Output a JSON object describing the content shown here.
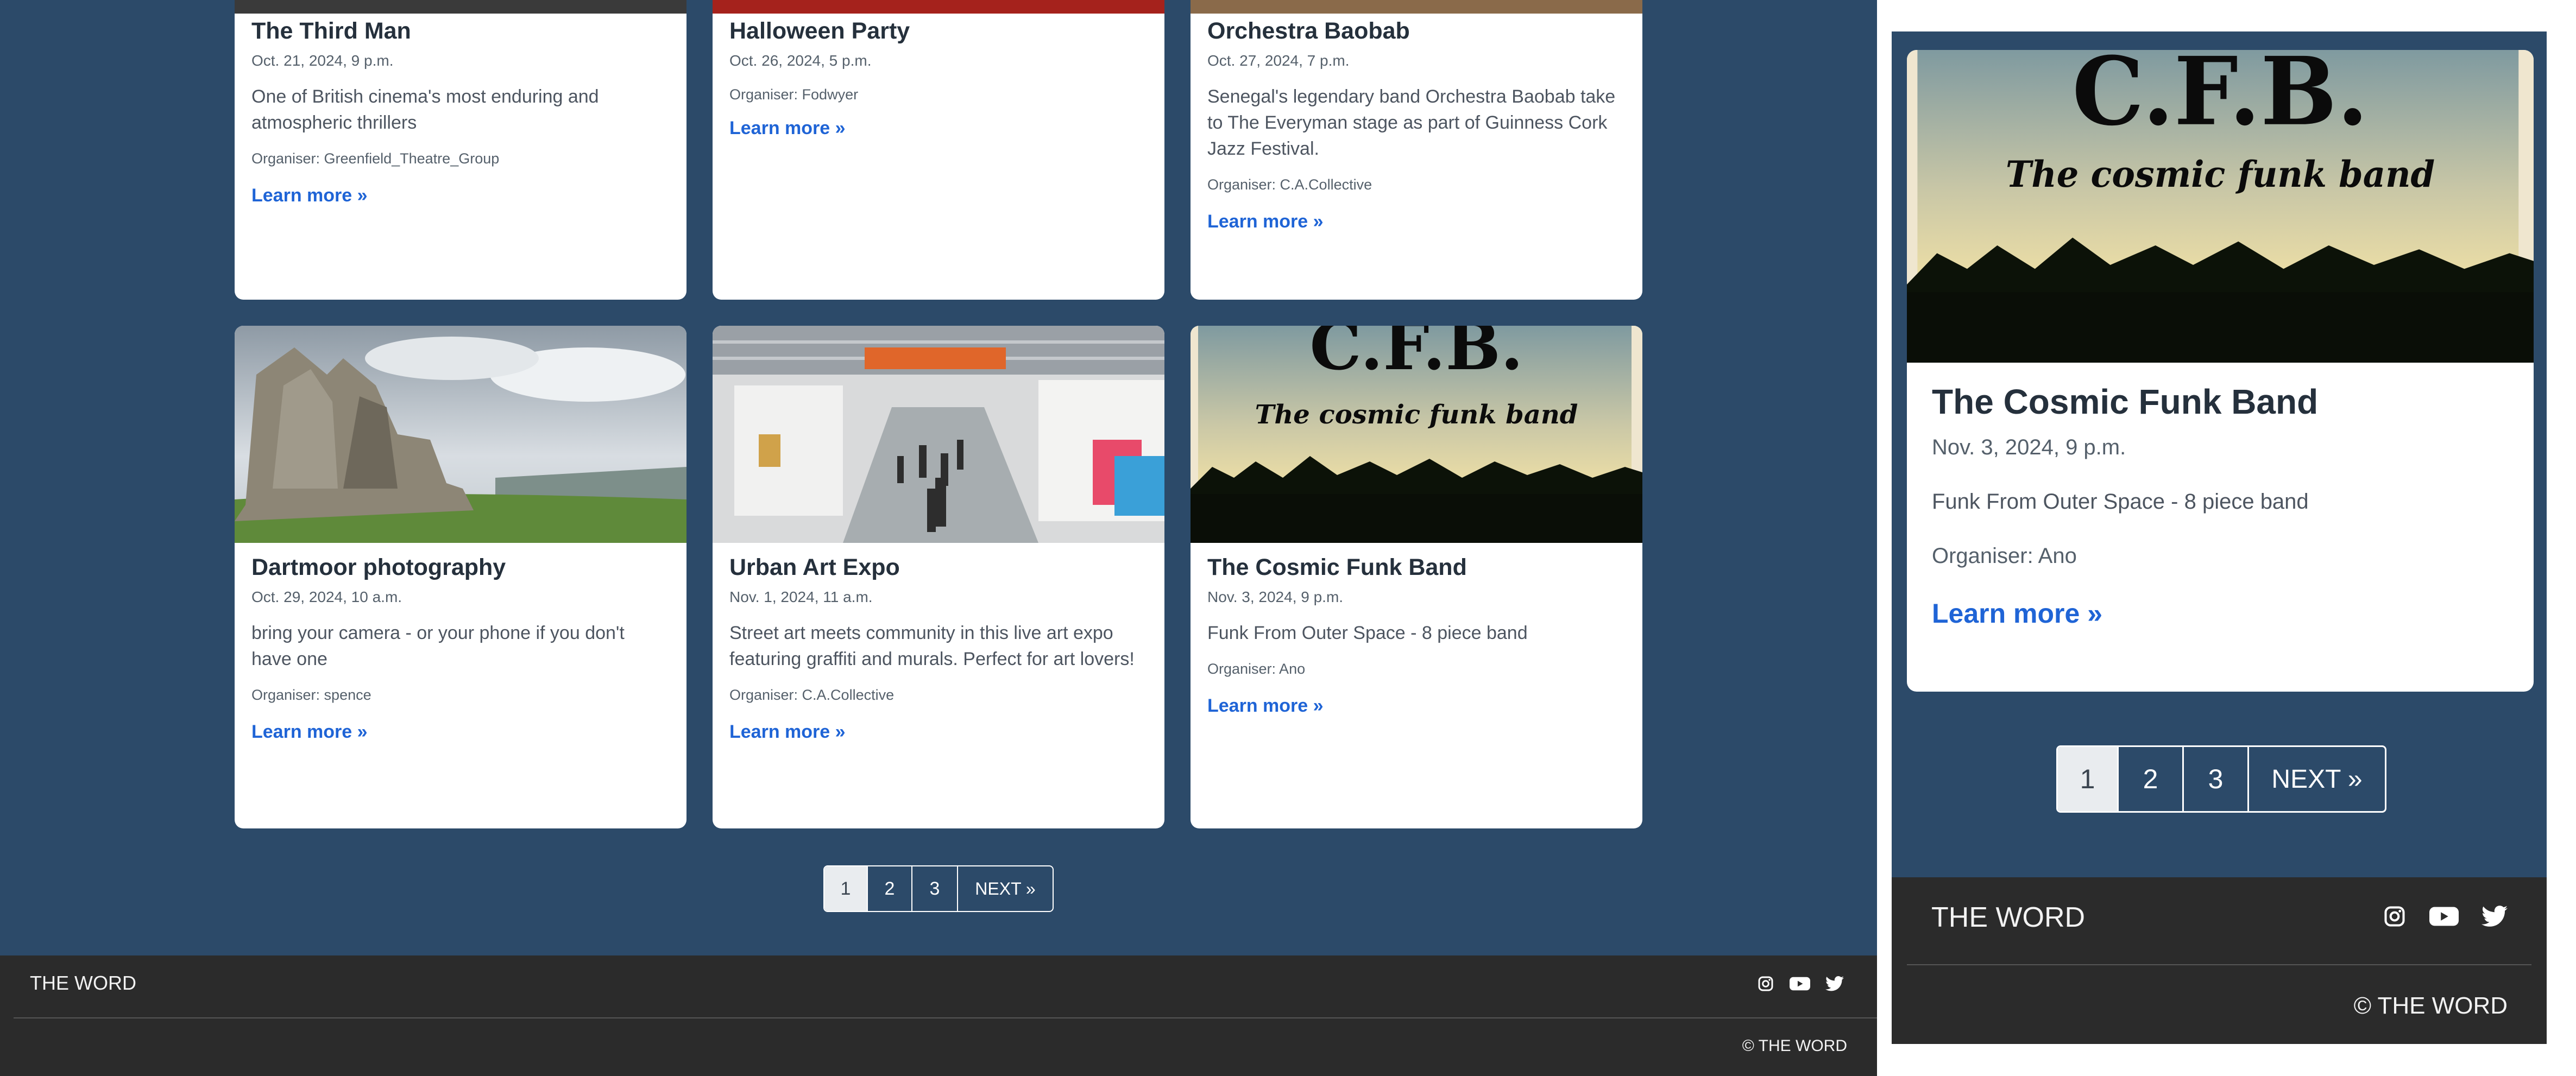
{
  "desktop": {
    "cards_row1": [
      {
        "title": "The Third Man",
        "date": "Oct. 21, 2024, 9 p.m.",
        "description": "One of British cinema's most enduring and atmospheric thrillers",
        "organiser": "Organiser: Greenfield_Theatre_Group",
        "link": "Learn more »"
      },
      {
        "title": "Halloween Party",
        "date": "Oct. 26, 2024, 5 p.m.",
        "description": "",
        "organiser": "Organiser: Fodwyer",
        "link": "Learn more »"
      },
      {
        "title": "Orchestra Baobab",
        "date": "Oct. 27, 2024, 7 p.m.",
        "description": "Senegal's legendary band Orchestra Baobab take to The Everyman stage as part of Guinness Cork Jazz Festival.",
        "organiser": "Organiser: C.A.Collective",
        "link": "Learn more »"
      }
    ],
    "cards_row2": [
      {
        "title": "Dartmoor photography",
        "date": "Oct. 29, 2024, 10 a.m.",
        "description": "bring your camera - or your phone if you don't have one",
        "organiser": "Organiser: spence",
        "link": "Learn more »",
        "image": "granite-tor-landscape-photo"
      },
      {
        "title": "Urban Art Expo",
        "date": "Nov. 1, 2024, 11 a.m.",
        "description": "Street art meets community in this live art expo featuring graffiti and murals. Perfect for art lovers!",
        "organiser": "Organiser: C.A.Collective",
        "link": "Learn more »",
        "image": "gallery-hall-photo"
      },
      {
        "title": "The Cosmic Funk Band",
        "date": "Nov. 3, 2024, 9 p.m.",
        "description": "Funk From Outer Space - 8 piece band",
        "organiser": "Organiser: Ano",
        "link": "Learn more »",
        "image": "cfb-band-poster"
      }
    ],
    "pagination": {
      "pages": [
        "1",
        "2",
        "3"
      ],
      "next": "NEXT »",
      "current": "1"
    },
    "footer": {
      "brand": "THE WORD",
      "copyright": "© THE WORD"
    }
  },
  "mobile": {
    "card": {
      "title": "The Cosmic Funk Band",
      "date": "Nov. 3, 2024, 9 p.m.",
      "description": "Funk From Outer Space - 8 piece band",
      "organiser": "Organiser: Ano",
      "link": "Learn more »",
      "image": "cfb-band-poster"
    },
    "pagination": {
      "pages": [
        "1",
        "2",
        "3"
      ],
      "next": "NEXT »",
      "current": "1"
    },
    "footer": {
      "brand": "THE WORD",
      "copyright": "© THE WORD"
    }
  },
  "poster": {
    "logo_text": "C.F.B.",
    "tagline": "The cosmic funk band"
  },
  "icons": [
    "instagram-icon",
    "youtube-icon",
    "twitter-icon"
  ],
  "colors": {
    "page_bg": "#2c4a69",
    "card_bg": "#ffffff",
    "link": "#1f64d6",
    "footer_bg": "#2b2b2b",
    "active_page_bg": "#e9ecef"
  }
}
